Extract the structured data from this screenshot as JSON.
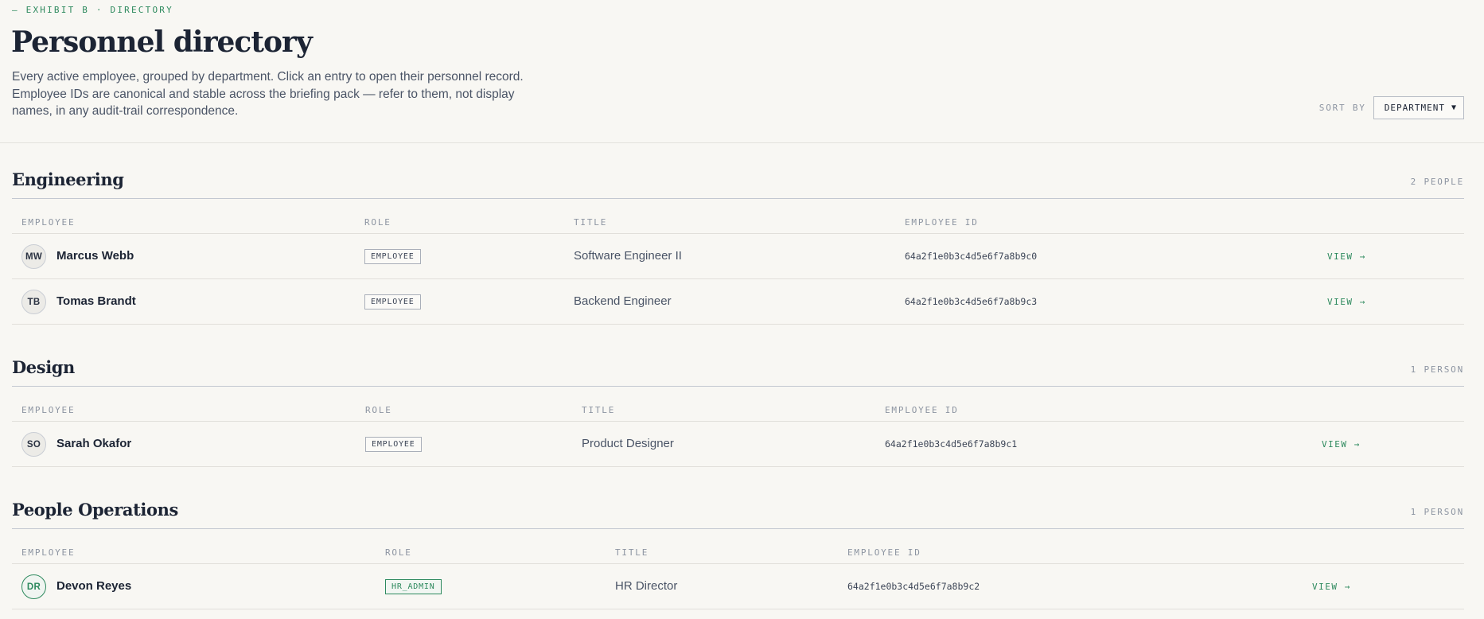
{
  "header": {
    "eyebrow": "— EXHIBIT B · DIRECTORY",
    "title": "Personnel directory",
    "intro": "Every active employee, grouped by department. Click an entry to open their personnel record. Employee IDs are canonical and stable across the briefing pack — refer to them, not display names, in any audit-trail correspondence.",
    "sort_label": "SORT BY",
    "sort_value": "DEPARTMENT"
  },
  "columns": {
    "employee": "EMPLOYEE",
    "role": "ROLE",
    "title": "TITLE",
    "employee_id": "EMPLOYEE ID"
  },
  "view_label": "VIEW →",
  "colors": {
    "accent": "#2e8a5e",
    "text": "#1c2434",
    "muted": "#8c94a1",
    "background": "#f8f7f3"
  },
  "departments": [
    {
      "name": "Engineering",
      "count": "2 PEOPLE",
      "employees": [
        {
          "initials": "MW",
          "name": "Marcus Webb",
          "role": "EMPLOYEE",
          "title": "Software Engineer II",
          "id": "64a2f1e0b3c4d5e6f7a8b9c0"
        },
        {
          "initials": "TB",
          "name": "Tomas Brandt",
          "role": "EMPLOYEE",
          "title": "Backend Engineer",
          "id": "64a2f1e0b3c4d5e6f7a8b9c3"
        }
      ]
    },
    {
      "name": "Design",
      "count": "1 PERSON",
      "employees": [
        {
          "initials": "SO",
          "name": "Sarah Okafor",
          "role": "EMPLOYEE",
          "title": "Product Designer",
          "id": "64a2f1e0b3c4d5e6f7a8b9c1"
        }
      ]
    },
    {
      "name": "People Operations",
      "count": "1 PERSON",
      "employees": [
        {
          "initials": "DR",
          "name": "Devon Reyes",
          "role": "HR_ADMIN",
          "title": "HR Director",
          "id": "64a2f1e0b3c4d5e6f7a8b9c2"
        }
      ]
    }
  ]
}
